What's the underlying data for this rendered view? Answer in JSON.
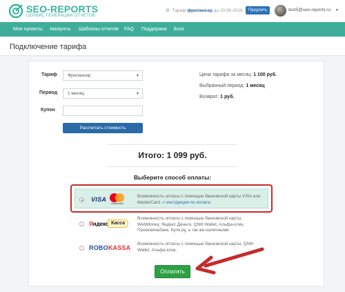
{
  "header": {
    "logo_title": "SEO-REPORTS",
    "logo_subtitle": "Сервис генерации отчетов",
    "tariff_prefix": "Тариф",
    "tariff_name": "фрилансер",
    "tariff_until": "до 20.06.2019",
    "extend_label": "Продлить",
    "user_email": "test5@seo-reports.ru",
    "user_caret": "▾"
  },
  "nav": {
    "items": [
      "Мои проекты",
      "Аккаунты",
      "Шаблоны отчетов",
      "FAQ",
      "Поддержка",
      "Блог"
    ]
  },
  "page": {
    "title": "Подключение тарифа"
  },
  "form": {
    "tariff_label": "Тариф",
    "tariff_value": "Фрилансер",
    "period_label": "Период",
    "period_value": "1 месяц",
    "coupon_label": "Купон",
    "coupon_value": "",
    "calc_button": "Рассчитать стоимость"
  },
  "summary": {
    "price_label": "Цена тарифа за месяц:",
    "price_value": "1 100 руб.",
    "period_label": "Выбранный период:",
    "period_value": "1 месяц",
    "refund_label": "Возврат:",
    "refund_value": "1 руб."
  },
  "total": "Итого: 1 099 руб.",
  "choose_payment": "Выберите способ оплаты:",
  "payments": {
    "card": {
      "logo_visa": "VISA",
      "logo_mc": "mastercard",
      "desc": "Возможность оплаты с помощью банковской карты VISA или MasterCard",
      "link": "-> инструкция по оплате."
    },
    "yandex": {
      "logo_1": "Я",
      "logo_2": "ндекс",
      "logo_kassa": "Касса",
      "desc": "Возможность оплаты с помощью банковской карты, WebMoney, Яндекс.Деньги, QIWI Wallet, Альфа-клик, Промсвязьбанк, Купи.ру, а так же наличными."
    },
    "robokassa": {
      "logo_1": "ROBO",
      "logo_2": "KASSA",
      "desc": "Возможность оплаты с помощью банковской карты, QIWI Wallet, Альфа-клик."
    }
  },
  "pay_button": "Оплатить",
  "colors": {
    "brand": "#3eae9b",
    "nav_bg": "#3eae9b",
    "primary_button": "#2a6aa8",
    "pay_button": "#2ea043",
    "highlight_border": "#c62a2a",
    "selected_bg": "#d9efe8"
  },
  "icons": {
    "logo": "seo-reports-logo-icon",
    "gear": "gear-icon",
    "avatar": "user-avatar",
    "arrow": "red-arrow-annotation"
  }
}
